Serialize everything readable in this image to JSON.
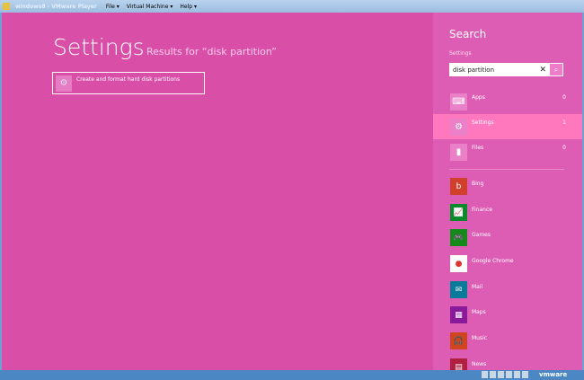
{
  "window": {
    "title": "windows8 - VMware Player",
    "menus": [
      "File",
      "Virtual Machine",
      "Help"
    ]
  },
  "main": {
    "heading": "Settings",
    "results_for": "Results for “disk partition”",
    "results": [
      {
        "label": "Create and format hard disk partitions",
        "icon": "disk-management-icon"
      }
    ]
  },
  "pane": {
    "title": "Search",
    "scope": "Settings",
    "search_value": "disk partition",
    "categories": [
      {
        "label": "Apps",
        "count": "0",
        "icon": "keyboard-icon"
      },
      {
        "label": "Settings",
        "count": "1",
        "icon": "gear-icon",
        "selected": true
      },
      {
        "label": "Files",
        "count": "0",
        "icon": "file-icon"
      }
    ],
    "apps": [
      {
        "label": "Bing",
        "color": "#d0402c"
      },
      {
        "label": "Finance",
        "color": "#0a8a2a"
      },
      {
        "label": "Games",
        "color": "#138a1a"
      },
      {
        "label": "Google Chrome",
        "color": "#ffffff"
      },
      {
        "label": "Mail",
        "color": "#0a7a9a"
      },
      {
        "label": "Maps",
        "color": "#8a1a9a"
      },
      {
        "label": "Music",
        "color": "#d04420"
      },
      {
        "label": "News",
        "color": "#b02040"
      }
    ]
  },
  "taskbar": {
    "brand": "vmware"
  }
}
